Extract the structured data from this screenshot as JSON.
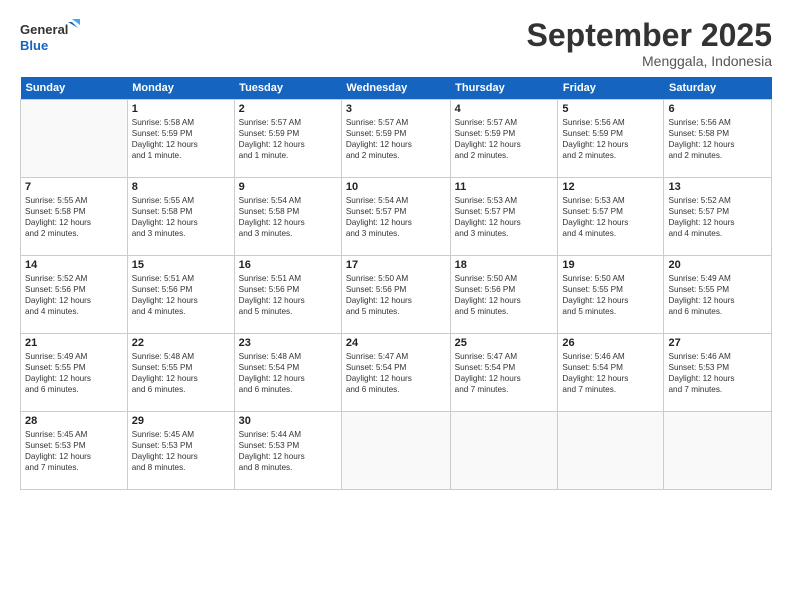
{
  "logo": {
    "line1": "General",
    "line2": "Blue"
  },
  "title": "September 2025",
  "subtitle": "Menggala, Indonesia",
  "headers": [
    "Sunday",
    "Monday",
    "Tuesday",
    "Wednesday",
    "Thursday",
    "Friday",
    "Saturday"
  ],
  "weeks": [
    [
      {
        "day": "",
        "info": ""
      },
      {
        "day": "1",
        "info": "Sunrise: 5:58 AM\nSunset: 5:59 PM\nDaylight: 12 hours\nand 1 minute."
      },
      {
        "day": "2",
        "info": "Sunrise: 5:57 AM\nSunset: 5:59 PM\nDaylight: 12 hours\nand 1 minute."
      },
      {
        "day": "3",
        "info": "Sunrise: 5:57 AM\nSunset: 5:59 PM\nDaylight: 12 hours\nand 2 minutes."
      },
      {
        "day": "4",
        "info": "Sunrise: 5:57 AM\nSunset: 5:59 PM\nDaylight: 12 hours\nand 2 minutes."
      },
      {
        "day": "5",
        "info": "Sunrise: 5:56 AM\nSunset: 5:59 PM\nDaylight: 12 hours\nand 2 minutes."
      },
      {
        "day": "6",
        "info": "Sunrise: 5:56 AM\nSunset: 5:58 PM\nDaylight: 12 hours\nand 2 minutes."
      }
    ],
    [
      {
        "day": "7",
        "info": "Sunrise: 5:55 AM\nSunset: 5:58 PM\nDaylight: 12 hours\nand 2 minutes."
      },
      {
        "day": "8",
        "info": "Sunrise: 5:55 AM\nSunset: 5:58 PM\nDaylight: 12 hours\nand 3 minutes."
      },
      {
        "day": "9",
        "info": "Sunrise: 5:54 AM\nSunset: 5:58 PM\nDaylight: 12 hours\nand 3 minutes."
      },
      {
        "day": "10",
        "info": "Sunrise: 5:54 AM\nSunset: 5:57 PM\nDaylight: 12 hours\nand 3 minutes."
      },
      {
        "day": "11",
        "info": "Sunrise: 5:53 AM\nSunset: 5:57 PM\nDaylight: 12 hours\nand 3 minutes."
      },
      {
        "day": "12",
        "info": "Sunrise: 5:53 AM\nSunset: 5:57 PM\nDaylight: 12 hours\nand 4 minutes."
      },
      {
        "day": "13",
        "info": "Sunrise: 5:52 AM\nSunset: 5:57 PM\nDaylight: 12 hours\nand 4 minutes."
      }
    ],
    [
      {
        "day": "14",
        "info": "Sunrise: 5:52 AM\nSunset: 5:56 PM\nDaylight: 12 hours\nand 4 minutes."
      },
      {
        "day": "15",
        "info": "Sunrise: 5:51 AM\nSunset: 5:56 PM\nDaylight: 12 hours\nand 4 minutes."
      },
      {
        "day": "16",
        "info": "Sunrise: 5:51 AM\nSunset: 5:56 PM\nDaylight: 12 hours\nand 5 minutes."
      },
      {
        "day": "17",
        "info": "Sunrise: 5:50 AM\nSunset: 5:56 PM\nDaylight: 12 hours\nand 5 minutes."
      },
      {
        "day": "18",
        "info": "Sunrise: 5:50 AM\nSunset: 5:56 PM\nDaylight: 12 hours\nand 5 minutes."
      },
      {
        "day": "19",
        "info": "Sunrise: 5:50 AM\nSunset: 5:55 PM\nDaylight: 12 hours\nand 5 minutes."
      },
      {
        "day": "20",
        "info": "Sunrise: 5:49 AM\nSunset: 5:55 PM\nDaylight: 12 hours\nand 6 minutes."
      }
    ],
    [
      {
        "day": "21",
        "info": "Sunrise: 5:49 AM\nSunset: 5:55 PM\nDaylight: 12 hours\nand 6 minutes."
      },
      {
        "day": "22",
        "info": "Sunrise: 5:48 AM\nSunset: 5:55 PM\nDaylight: 12 hours\nand 6 minutes."
      },
      {
        "day": "23",
        "info": "Sunrise: 5:48 AM\nSunset: 5:54 PM\nDaylight: 12 hours\nand 6 minutes."
      },
      {
        "day": "24",
        "info": "Sunrise: 5:47 AM\nSunset: 5:54 PM\nDaylight: 12 hours\nand 6 minutes."
      },
      {
        "day": "25",
        "info": "Sunrise: 5:47 AM\nSunset: 5:54 PM\nDaylight: 12 hours\nand 7 minutes."
      },
      {
        "day": "26",
        "info": "Sunrise: 5:46 AM\nSunset: 5:54 PM\nDaylight: 12 hours\nand 7 minutes."
      },
      {
        "day": "27",
        "info": "Sunrise: 5:46 AM\nSunset: 5:53 PM\nDaylight: 12 hours\nand 7 minutes."
      }
    ],
    [
      {
        "day": "28",
        "info": "Sunrise: 5:45 AM\nSunset: 5:53 PM\nDaylight: 12 hours\nand 7 minutes."
      },
      {
        "day": "29",
        "info": "Sunrise: 5:45 AM\nSunset: 5:53 PM\nDaylight: 12 hours\nand 8 minutes."
      },
      {
        "day": "30",
        "info": "Sunrise: 5:44 AM\nSunset: 5:53 PM\nDaylight: 12 hours\nand 8 minutes."
      },
      {
        "day": "",
        "info": ""
      },
      {
        "day": "",
        "info": ""
      },
      {
        "day": "",
        "info": ""
      },
      {
        "day": "",
        "info": ""
      }
    ]
  ]
}
